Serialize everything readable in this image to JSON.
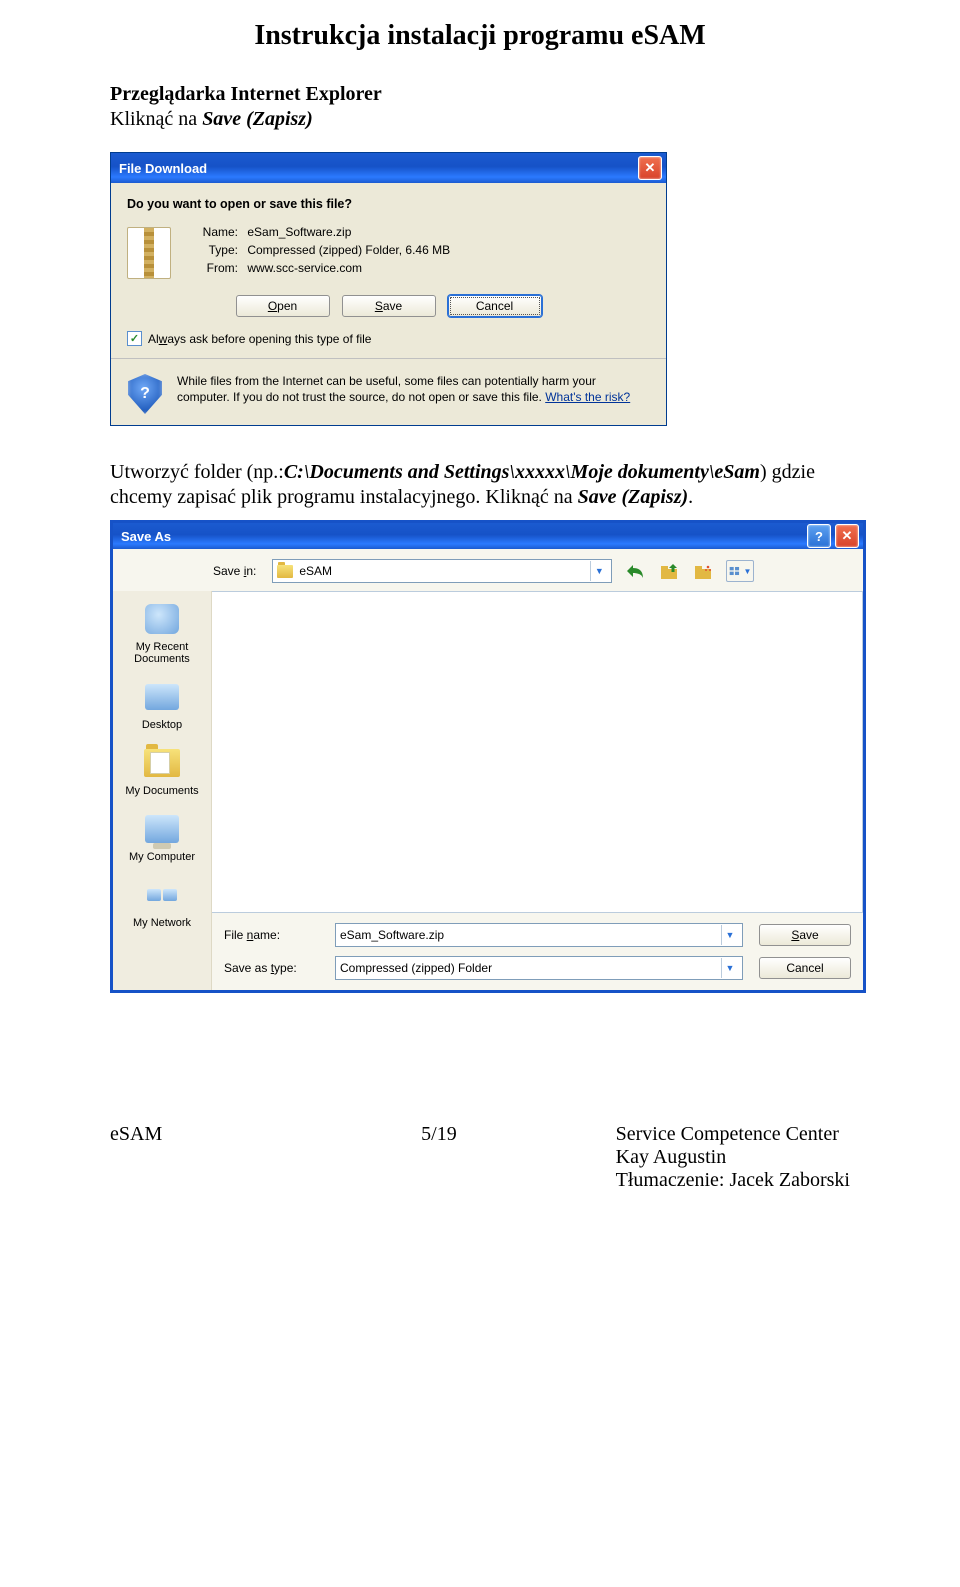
{
  "doc": {
    "title": "Instrukcja instalacji programu eSAM",
    "para1_strong": "Przeglądarka Internet Explorer",
    "para1_line2a": "Kliknąć na ",
    "para1_line2b": "Save (Zapisz)",
    "para2_a": "Utworzyć folder (np.:",
    "para2_b": "C:\\Documents and Settings\\xxxxx\\Moje dokumenty\\eSam",
    "para2_c": ") gdzie chcemy zapisać plik programu instalacyjnego. Kliknąć na ",
    "para2_d": "Save (Zapisz)",
    "para2_e": "."
  },
  "dl": {
    "title": "File Download",
    "question": "Do you want to open or save this file?",
    "name_lbl": "Name:",
    "name_val": "eSam_Software.zip",
    "type_lbl": "Type:",
    "type_val": "Compressed (zipped) Folder, 6.46 MB",
    "from_lbl": "From:",
    "from_val": "www.scc-service.com",
    "btn_open": "Open",
    "btn_save": "Save",
    "btn_cancel": "Cancel",
    "chk_label_pre": "Al",
    "chk_label_u": "w",
    "chk_label_post": "ays ask before opening this type of file",
    "warn1": "While files from the Internet can be useful, some files can potentially harm your computer. If you do not trust the source, do not open or save this file. ",
    "warn_link": "What's the risk?"
  },
  "sa": {
    "title": "Save As",
    "savein_lbl": "Save in:",
    "folder": "eSAM",
    "places": {
      "recent": "My Recent Documents",
      "desktop": "Desktop",
      "docs": "My Documents",
      "comp": "My Computer",
      "net": "My Network"
    },
    "filename_lbl": "File name:",
    "filename_val": "eSam_Software.zip",
    "savetype_lbl": "Save as type:",
    "savetype_val": "Compressed (zipped) Folder",
    "btn_save": "Save",
    "btn_cancel": "Cancel"
  },
  "footer": {
    "left": "eSAM",
    "mid": "5/19",
    "r1": "Service Competence Center",
    "r2": "Kay Augustin",
    "r3": "Tłumaczenie: Jacek Zaborski"
  }
}
